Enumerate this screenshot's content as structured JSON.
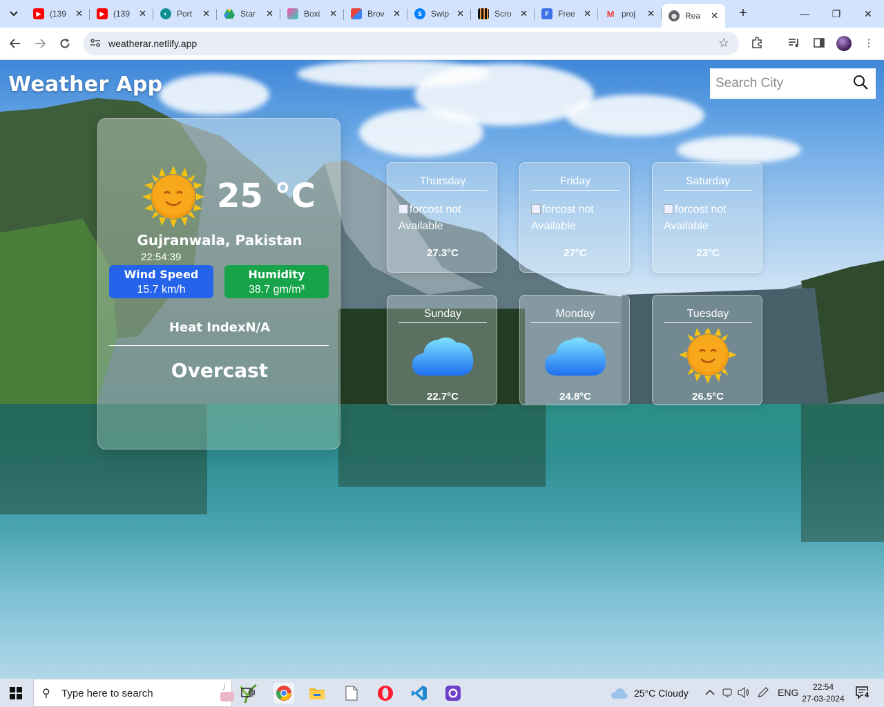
{
  "browser": {
    "tabs": [
      {
        "title": "(139",
        "icon": "youtube-icon",
        "color": "#ff0000"
      },
      {
        "title": "(139",
        "icon": "youtube-icon",
        "color": "#ff0000"
      },
      {
        "title": "Port",
        "icon": "portfolio-icon",
        "color": "#0e8f8f"
      },
      {
        "title": "Star",
        "icon": "google-drive-icon",
        "color": "#1fa463"
      },
      {
        "title": "Boxi",
        "icon": "boxicons-icon",
        "color": "#7b2ff7"
      },
      {
        "title": "Brov",
        "icon": "browse-icon",
        "color": "#e8453c"
      },
      {
        "title": "Swip",
        "icon": "swiper-icon",
        "color": "#0080ff"
      },
      {
        "title": "Scro",
        "icon": "scroll-icon",
        "color": "#222222"
      },
      {
        "title": "Free",
        "icon": "forms-icon",
        "color": "#3b73e6"
      },
      {
        "title": "proj",
        "icon": "gmail-icon",
        "color": "#ea4335"
      },
      {
        "title": "Rea",
        "icon": "globe-icon",
        "color": "#5f6368",
        "active": true
      }
    ],
    "url": "weatherar.netlify.app"
  },
  "app": {
    "title": "Weather App",
    "search_placeholder": "Search City"
  },
  "current": {
    "temperature": "25 °C",
    "location": "Gujranwala, Pakistan",
    "time": "22:54:39",
    "wind_label": "Wind Speed",
    "wind_value": "15.7 km/h",
    "humidity_label": "Humidity",
    "humidity_value": "38.7 gm/m³",
    "heat_index": "Heat IndexN/A",
    "condition": "Overcast",
    "icon": "sun-icon"
  },
  "forecast": [
    {
      "day": "Thursday",
      "alt": "forcost not Available",
      "temp": "27.3°C"
    },
    {
      "day": "Friday",
      "alt": "forcost not Available",
      "temp": "27°C"
    },
    {
      "day": "Saturday",
      "alt": "forcost not Available",
      "temp": "23°C"
    },
    {
      "day": "Sunday",
      "icon": "cloud-icon",
      "temp": "22.7°C"
    },
    {
      "day": "Monday",
      "icon": "cloud-icon",
      "temp": "24.8°C"
    },
    {
      "day": "Tuesday",
      "icon": "sun-icon",
      "temp": "26.5°C"
    }
  ],
  "taskbar": {
    "search_text": "Type here to search",
    "weather": "25°C  Cloudy",
    "language": "ENG",
    "time": "22:54",
    "date": "27-03-2024",
    "notifications": "4"
  },
  "colors": {
    "wind_pill": "#2563eb",
    "humidity_pill": "#16a34a",
    "chrome_tabbar": "#d3e3fd"
  }
}
